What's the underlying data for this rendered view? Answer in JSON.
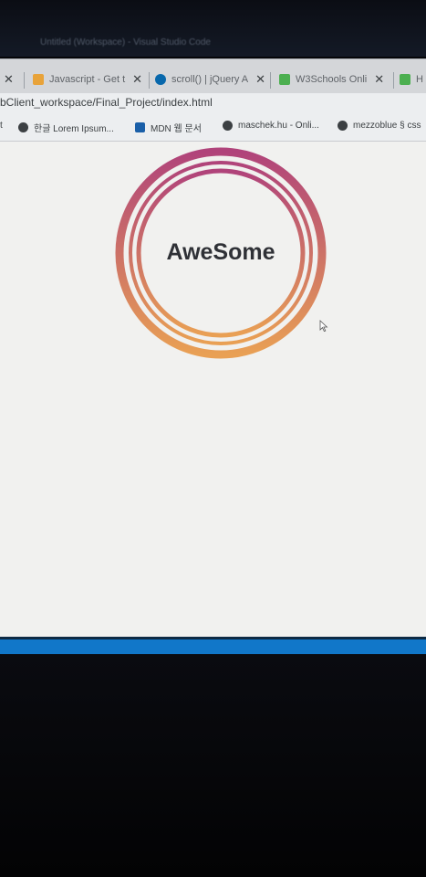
{
  "window": {
    "title": "Untitled (Workspace) - Visual Studio Code"
  },
  "tabs": [
    {
      "label": "Javascript - Get t",
      "icon": "pencil-icon",
      "color": "#e8a33a"
    },
    {
      "label": "scroll() | jQuery A",
      "icon": "jquery-icon",
      "color": "#0868ac"
    },
    {
      "label": "W3Schools Onli",
      "icon": "w3schools-icon",
      "color": "#4caf50"
    },
    {
      "label": "H",
      "icon": "w3schools-icon",
      "color": "#4caf50"
    }
  ],
  "address": {
    "url": "bClient_workspace/Final_Project/index.html"
  },
  "bookmarks": [
    {
      "label": "t"
    },
    {
      "label": "한글 Lorem Ipsum..."
    },
    {
      "label": "MDN 웹 문서"
    },
    {
      "label": "maschek.hu - Onli..."
    },
    {
      "label": "mezzoblue § css"
    }
  ],
  "page": {
    "heading": "AweSome",
    "gradient_top": "#b0437a",
    "gradient_bottom": "#e9a054"
  },
  "colors": {
    "statusbar": "#1177c9"
  }
}
